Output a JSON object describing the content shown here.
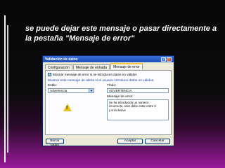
{
  "headline": "se puede dejar este mensaje o pasar directamente a la pestaña \"Mensaje de error\"",
  "dialog": {
    "title": "Validación de datos",
    "help_label": "?",
    "close_label": "×",
    "tabs": [
      "Configuración",
      "Mensaje de entrada",
      "Mensaje de error"
    ],
    "checkbox_label": "Mostrar mensaje de error si se introducen datos no válidos",
    "checkbox_mark": "✓",
    "instruction": "Mostrar este mensaje de alerta si el usuario introduce datos no válidos:",
    "style_label": "Estilo:",
    "style_value": "Advertencia",
    "title_label": "Título:",
    "title_value": "ADVERTENCIA",
    "message_label": "Mensaje de error:",
    "message_value": "Se ha introducido un numero\nincorrecto, este debe estar entre 0\ny 8 inclusive",
    "warning_mark": "!",
    "clear_all_button": "Borrar todos",
    "ok_button": "Aceptar",
    "cancel_button": "Cancelar"
  }
}
